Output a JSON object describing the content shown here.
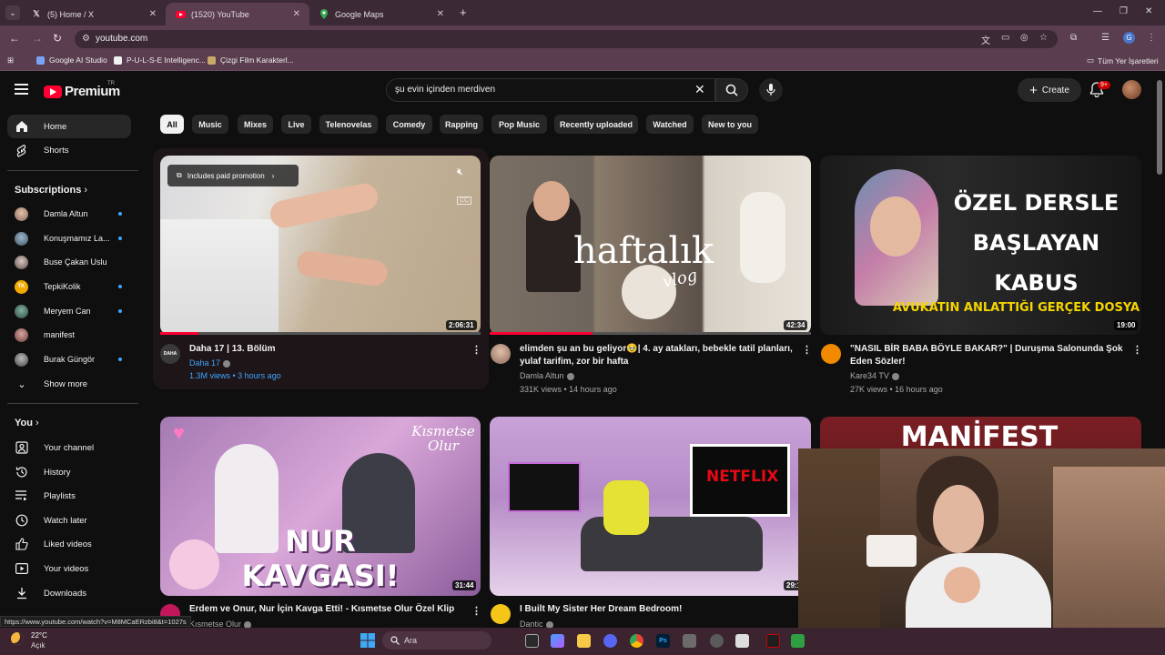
{
  "browser": {
    "tabs": [
      {
        "label": "(5) Home / X",
        "icon": "x-logo-icon"
      },
      {
        "label": "(1520) YouTube",
        "icon": "youtube-icon",
        "active": true
      },
      {
        "label": "Google Maps",
        "icon": "maps-pin-icon"
      }
    ],
    "url": "youtube.com",
    "bookmarks": [
      {
        "label": "Google AI Studio"
      },
      {
        "label": "P-U-L-S-E Intelligenc..."
      },
      {
        "label": "Çizgi Film Karakterl..."
      }
    ],
    "bookmarks_all": "Tüm Yer İşaretleri",
    "profile_initial": "G"
  },
  "header": {
    "logo_text": "Premium",
    "logo_super": "TR",
    "search_value": "şu evin içinden merdiven",
    "create_label": "Create",
    "notifications_badge": "9+"
  },
  "sidebar": {
    "main": [
      {
        "label": "Home",
        "icon": "home-icon",
        "active": true
      },
      {
        "label": "Shorts",
        "icon": "shorts-icon"
      }
    ],
    "subscriptions_title": "Subscriptions",
    "subscriptions": [
      {
        "label": "Damla Altun",
        "dot": true
      },
      {
        "label": "Konuşmamız La...",
        "dot": true
      },
      {
        "label": "Buse Çakan Uslu",
        "dot": false
      },
      {
        "label": "TepkiKolik",
        "dot": true
      },
      {
        "label": "Meryem Can",
        "dot": true
      },
      {
        "label": "manifest",
        "dot": false
      },
      {
        "label": "Burak Güngör",
        "dot": true
      }
    ],
    "show_more": "Show more",
    "you_title": "You",
    "you_items": [
      {
        "label": "Your channel",
        "icon": "channel-icon"
      },
      {
        "label": "History",
        "icon": "history-icon"
      },
      {
        "label": "Playlists",
        "icon": "playlists-icon"
      },
      {
        "label": "Watch later",
        "icon": "clock-icon"
      },
      {
        "label": "Liked videos",
        "icon": "thumbs-up-icon"
      },
      {
        "label": "Your videos",
        "icon": "video-icon"
      },
      {
        "label": "Downloads",
        "icon": "download-icon"
      }
    ]
  },
  "chips": [
    "All",
    "Music",
    "Mixes",
    "Live",
    "Telenovelas",
    "Comedy",
    "Rapping",
    "Pop Music",
    "Recently uploaded",
    "Watched",
    "New to you"
  ],
  "videos": [
    {
      "title": "Daha 17 | 13. Bölüm",
      "channel": "Daha 17",
      "meta": "1.3M views • 3 hours ago",
      "duration": "2:06:31",
      "promo": "Includes paid promotion",
      "progress": 0.12
    },
    {
      "title": "elimden şu an bu geliyor🥹| 4. ay atakları, bebekle tatil planları, yulaf tarifim, zor bir hafta",
      "channel": "Damla Altun",
      "meta": "331K views • 14 hours ago",
      "duration": "42:34",
      "thumb_text": "haftalık",
      "thumb_sub": "vlog",
      "progress": 0.32
    },
    {
      "title": "\"NASIL BİR BABA BÖYLE BAKAR?\" | Duruşma Salonunda Şok Eden Sözler!",
      "channel": "Kare34 TV",
      "meta": "27K views • 16 hours ago",
      "duration": "19:00",
      "thumb_lines": [
        "ÖZEL DERSLE",
        "BAŞLAYAN",
        "KABUS"
      ],
      "thumb_footer": "AVUKATIN ANLATTIĞI GERÇEK DOSYA"
    },
    {
      "title": "Erdem ve Onur, Nur İçin Kavga Etti! - Kısmetse Olur Özel Klip",
      "channel": "Kısmetse Olur",
      "duration": "31:44",
      "thumb_lines": [
        "NUR",
        "KAVGASI!"
      ],
      "thumb_corner": "Kısmetse Olur"
    },
    {
      "title": "I Built My Sister Her Dream Bedroom!",
      "channel": "Dantic",
      "duration": "29:1",
      "thumb_text": "NETFLIX"
    },
    {
      "title": "",
      "thumb_text": "MANİFEST"
    }
  ],
  "status_url": "https://www.youtube.com/watch?v=M8MCaERzbi8&t=1027s",
  "taskbar": {
    "temp": "22°C",
    "condition": "Açık",
    "search": "Ara"
  }
}
